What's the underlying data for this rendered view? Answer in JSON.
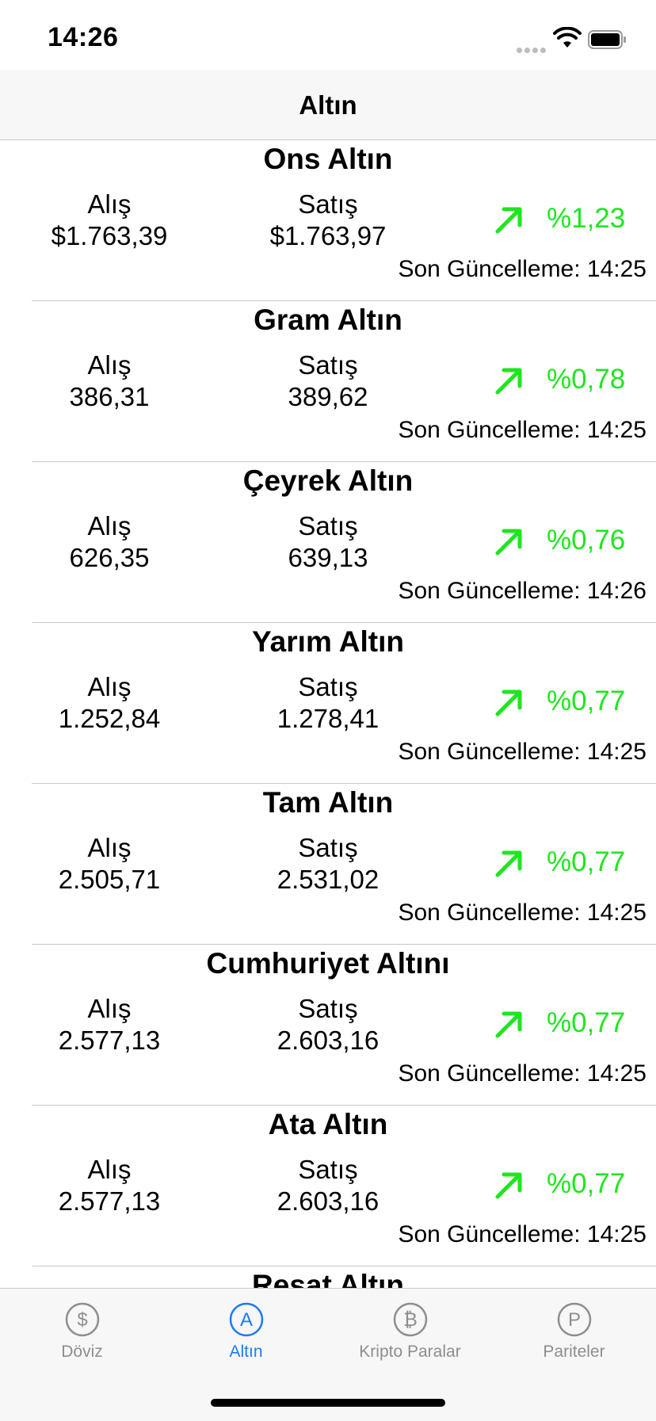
{
  "status_bar": {
    "time": "14:26"
  },
  "nav": {
    "title": "Altın"
  },
  "labels": {
    "buy": "Alış",
    "sell": "Satış",
    "updated_prefix": "Son Güncelleme:"
  },
  "colors": {
    "up": "#1ee61e",
    "accent": "#1a7cf5",
    "inactive": "#8e8e8e"
  },
  "rows": [
    {
      "name": "Ons Altın",
      "buy": "$1.763,39",
      "sell": "$1.763,97",
      "trend": "up-right-arrow",
      "change": "%1,23",
      "updated": "Son Güncelleme: 14:25"
    },
    {
      "name": "Gram Altın",
      "buy": "386,31",
      "sell": "389,62",
      "trend": "up-right-arrow",
      "change": "%0,78",
      "updated": "Son Güncelleme: 14:25"
    },
    {
      "name": "Çeyrek Altın",
      "buy": "626,35",
      "sell": "639,13",
      "trend": "up-right-arrow",
      "change": "%0,76",
      "updated": "Son Güncelleme: 14:26"
    },
    {
      "name": "Yarım Altın",
      "buy": "1.252,84",
      "sell": "1.278,41",
      "trend": "up-right-arrow",
      "change": "%0,77",
      "updated": "Son Güncelleme: 14:25"
    },
    {
      "name": "Tam Altın",
      "buy": "2.505,71",
      "sell": "2.531,02",
      "trend": "up-right-arrow",
      "change": "%0,77",
      "updated": "Son Güncelleme: 14:25"
    },
    {
      "name": "Cumhuriyet Altını",
      "buy": "2.577,13",
      "sell": "2.603,16",
      "trend": "up-right-arrow",
      "change": "%0,77",
      "updated": "Son Güncelleme: 14:25"
    },
    {
      "name": "Ata Altın",
      "buy": "2.577,13",
      "sell": "2.603,16",
      "trend": "up-right-arrow",
      "change": "%0,77",
      "updated": "Son Güncelleme: 14:25"
    },
    {
      "name": "Reşat Altın"
    }
  ],
  "tabs": [
    {
      "label": "Döviz",
      "icon": "dollar-icon",
      "glyph": "$"
    },
    {
      "label": "Altın",
      "icon": "gold-a-icon",
      "glyph": "A",
      "selected": true
    },
    {
      "label": "Kripto Paralar",
      "icon": "bitcoin-icon",
      "glyph": "₿"
    },
    {
      "label": "Pariteler",
      "icon": "parity-p-icon",
      "glyph": "P"
    }
  ]
}
